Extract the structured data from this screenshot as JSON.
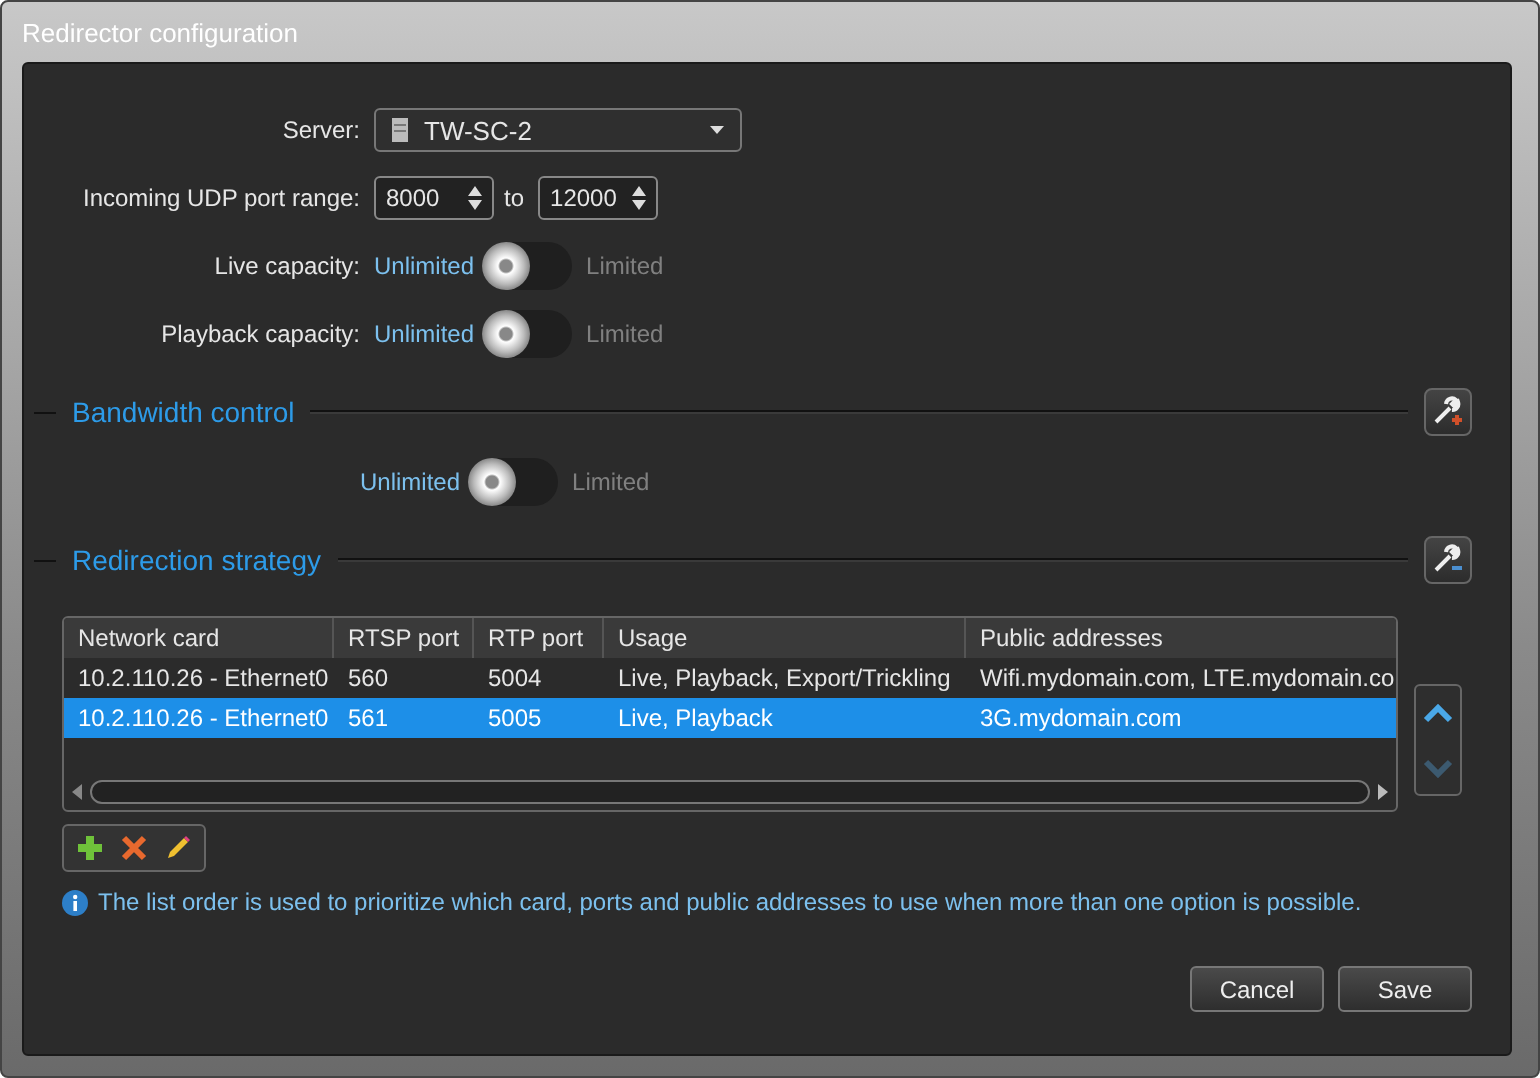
{
  "window": {
    "title": "Redirector configuration"
  },
  "server": {
    "label": "Server:",
    "value": "TW-SC-2"
  },
  "port_range": {
    "label": "Incoming UDP port range:",
    "from": "8000",
    "separator": "to",
    "to": "12000"
  },
  "capacities": [
    {
      "label": "Live capacity:",
      "off_label": "Unlimited",
      "on_label": "Limited",
      "on": false
    },
    {
      "label": "Playback capacity:",
      "off_label": "Unlimited",
      "on_label": "Limited",
      "on": false
    }
  ],
  "bandwidth_control": {
    "title": "Bandwidth control",
    "off_label": "Unlimited",
    "on_label": "Limited",
    "on": false
  },
  "redirection_strategy": {
    "title": "Redirection strategy",
    "table": {
      "columns": [
        "Network card",
        "RTSP port",
        "RTP port",
        "Usage",
        "Public addresses"
      ],
      "rows": [
        {
          "cells": [
            "10.2.110.26 - Ethernet0",
            "560",
            "5004",
            "Live, Playback, Export/Trickling",
            "Wifi.mydomain.com, LTE.mydomain.co"
          ],
          "selected": false
        },
        {
          "cells": [
            "10.2.110.26 - Ethernet0",
            "561",
            "5005",
            "Live, Playback",
            "3G.mydomain.com"
          ],
          "selected": true
        }
      ]
    },
    "info": "The list order is used to prioritize which card, ports and public addresses to use when more than one option is possible."
  },
  "buttons": [
    {
      "label": "Cancel"
    },
    {
      "label": "Save"
    }
  ]
}
